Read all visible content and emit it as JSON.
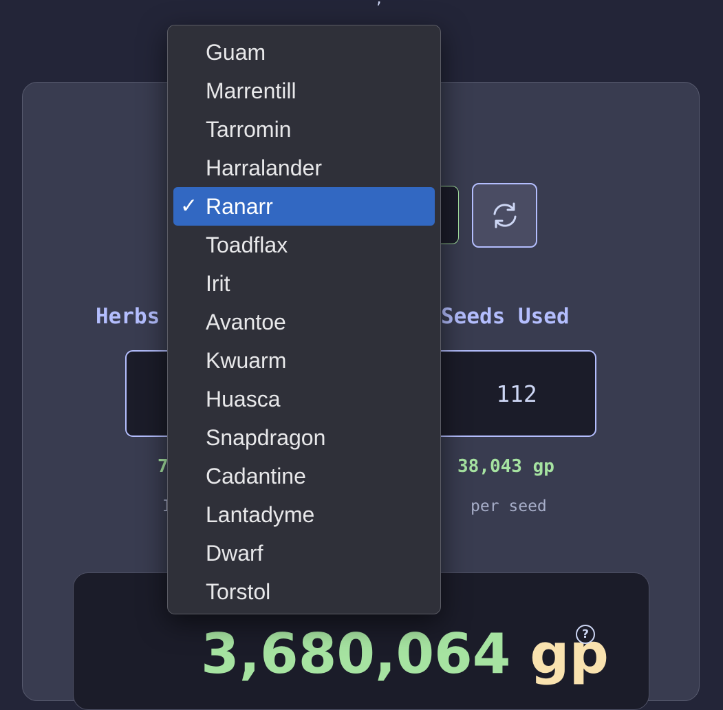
{
  "page": {
    "top_fragment": ","
  },
  "herb_dropdown": {
    "options": [
      "Guam",
      "Marrentill",
      "Tarromin",
      "Harralander",
      "Ranarr",
      "Toadflax",
      "Irit",
      "Avantoe",
      "Kwuarm",
      "Huasca",
      "Snapdragon",
      "Cadantine",
      "Lantadyme",
      "Dwarf",
      "Torstol"
    ],
    "selected": "Ranarr",
    "check_glyph": "✓"
  },
  "refresh_button": {
    "icon": "refresh-icon"
  },
  "herbs_section": {
    "label": "Herbs",
    "price_fragment": "7",
    "note_fragment": "I"
  },
  "seeds_section": {
    "label": "Seeds Used",
    "value": "112",
    "price": "38,043 gp",
    "note": "per seed"
  },
  "result": {
    "amount": "3,680,064",
    "suffix": "gp",
    "help_icon": "?"
  },
  "colors": {
    "background": "#232538",
    "card": "#393c50",
    "accent_lavender": "#b4befe",
    "accent_green": "#a6e3a1",
    "accent_gold": "#f9e2af",
    "selection_blue": "#3268c2"
  }
}
